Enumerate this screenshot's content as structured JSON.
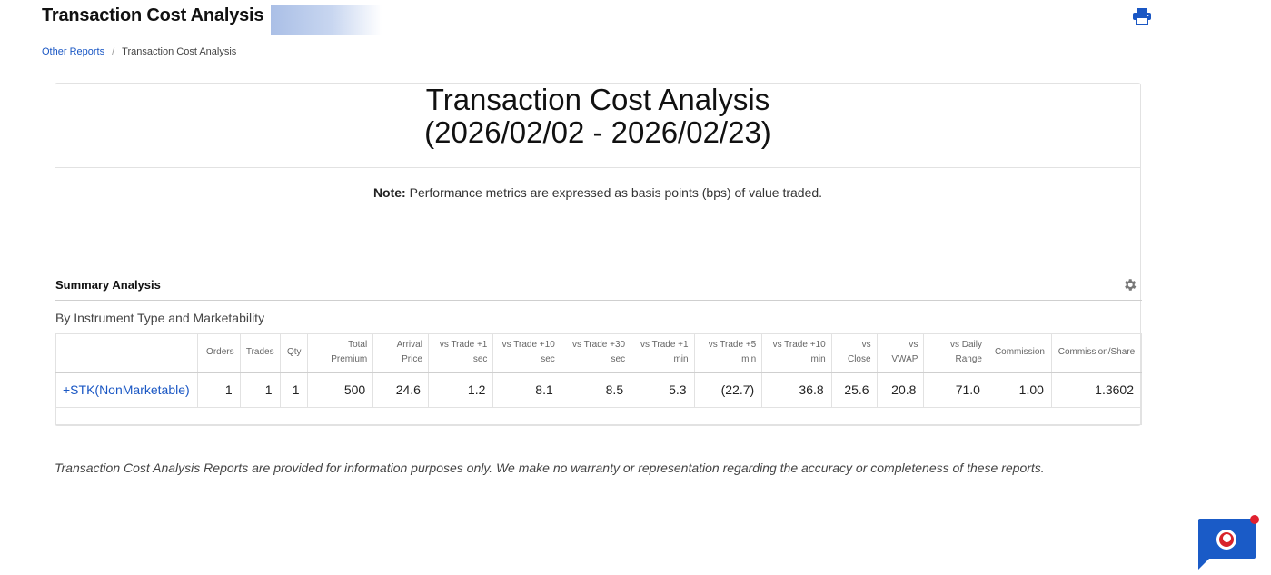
{
  "header": {
    "title": "Transaction Cost Analysis"
  },
  "breadcrumb": {
    "parent": "Other Reports",
    "separator": "/",
    "current": "Transaction Cost Analysis"
  },
  "report": {
    "heading_line1": "Transaction Cost Analysis",
    "heading_line2": "(2026/02/02 - 2026/02/23)",
    "note_label": "Note:",
    "note_text": " Performance metrics are expressed as basis points (bps) of value traded."
  },
  "summary": {
    "title": "Summary Analysis",
    "subtitle": "By Instrument Type and Marketability",
    "columns": [
      "",
      "Orders",
      "Trades",
      "Qty",
      "Total Premium",
      "Arrival Price",
      "vs Trade +1 sec",
      "vs Trade +10 sec",
      "vs Trade +30 sec",
      "vs Trade +1 min",
      "vs Trade +5 min",
      "vs Trade +10 min",
      "vs Close",
      "vs VWAP",
      "vs Daily Range",
      "Commission",
      "Commission/Share"
    ],
    "rows": [
      {
        "instrument": "+STK(NonMarketable)",
        "cells": [
          "1",
          "1",
          "1",
          "500",
          "24.6",
          "1.2",
          "8.1",
          "8.5",
          "5.3",
          "(22.7)",
          "36.8",
          "25.6",
          "20.8",
          "71.0",
          "1.00",
          "1.3602"
        ]
      }
    ]
  },
  "footer": {
    "disclaimer": "Transaction Cost Analysis Reports are provided for information purposes only. We make no warranty or representation regarding the accuracy or completeness of these reports."
  },
  "icons": {
    "print": "print-icon",
    "settings": "gear-icon",
    "chat": "chat-icon"
  },
  "colors": {
    "link": "#1a57c4",
    "chat_widget": "#1a5bc7",
    "notification_dot": "#e0202f"
  }
}
